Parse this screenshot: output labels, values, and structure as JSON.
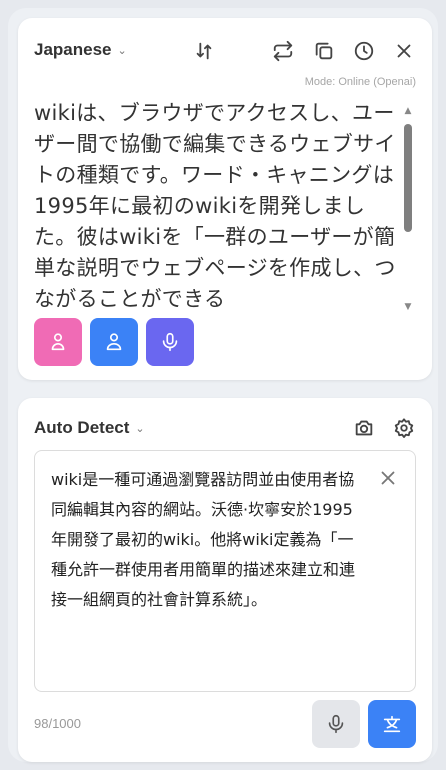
{
  "source": {
    "language": "Japanese",
    "mode": "Mode: Online (Openai)",
    "text": "wikiは、ブラウザでアクセスし、ユーザー間で協働で編集できるウェブサイトの種類です。ワード・キャニングは1995年に最初のwikiを開発しました。彼はwikiを「一群のユーザーが簡単な説明でウェブページを作成し、つながることができる",
    "icons": [
      "swap-arrows-icon",
      "repeat-icon",
      "copy-icon",
      "history-icon",
      "close-icon"
    ],
    "voices": [
      {
        "name": "female-voice",
        "color": "#f06bb5"
      },
      {
        "name": "male-voice",
        "color": "#3b82f6"
      },
      {
        "name": "microphone",
        "color": "#6a67f0"
      }
    ]
  },
  "target": {
    "language": "Auto Detect",
    "text": "wiki是一種可通過瀏覽器訪問並由使用者協同編輯其內容的網站。沃德·坎寧安於1995年開發了最初的wiki。他將wiki定義為「一種允許一群使用者用簡單的描述來建立和連接一組網頁的社會計算系統」。",
    "char_count": "98/1000",
    "icons": [
      "camera-icon",
      "settings-icon",
      "microphone-icon",
      "translate-icon"
    ],
    "accent": "#3b82f6"
  }
}
